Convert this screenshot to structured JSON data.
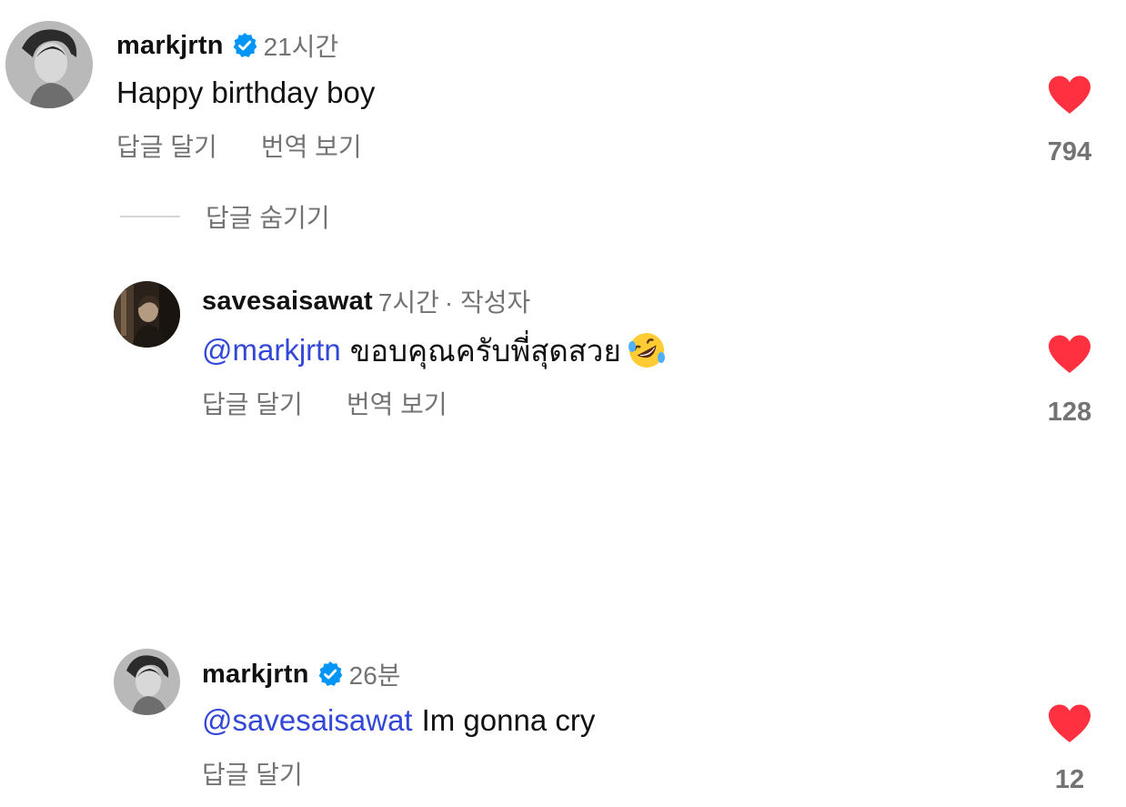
{
  "comments": [
    {
      "username": "markjrtn",
      "verified": true,
      "time": "21시간",
      "author_tag": "",
      "mention": "",
      "text": "Happy birthday boy",
      "actions": [
        "답글 달기",
        "번역 보기"
      ],
      "likes": "794",
      "avatar": "grayscale-portrait"
    },
    {
      "username": "savesaisawat",
      "verified": false,
      "time": "7시간",
      "author_tag": "· 작성자",
      "mention": "@markjrtn",
      "text": "ขอบคุณครับพี่สุดสวย",
      "emoji": "rolling-on-floor-laughing-emoji",
      "actions": [
        "답글 달기",
        "번역 보기"
      ],
      "likes": "128",
      "avatar": "dark-portrait"
    },
    {
      "username": "markjrtn",
      "verified": true,
      "time": "26분",
      "author_tag": "",
      "mention": "@savesaisawat",
      "text": "Im gonna cry",
      "actions": [
        "답글 달기"
      ],
      "likes": "12",
      "avatar": "grayscale-portrait"
    }
  ],
  "replies_toggle": {
    "label": "답글 숨기기"
  },
  "colors": {
    "like": "#ff3040",
    "mention": "#3348d6",
    "verified": "#0095f6",
    "muted": "#737373"
  }
}
